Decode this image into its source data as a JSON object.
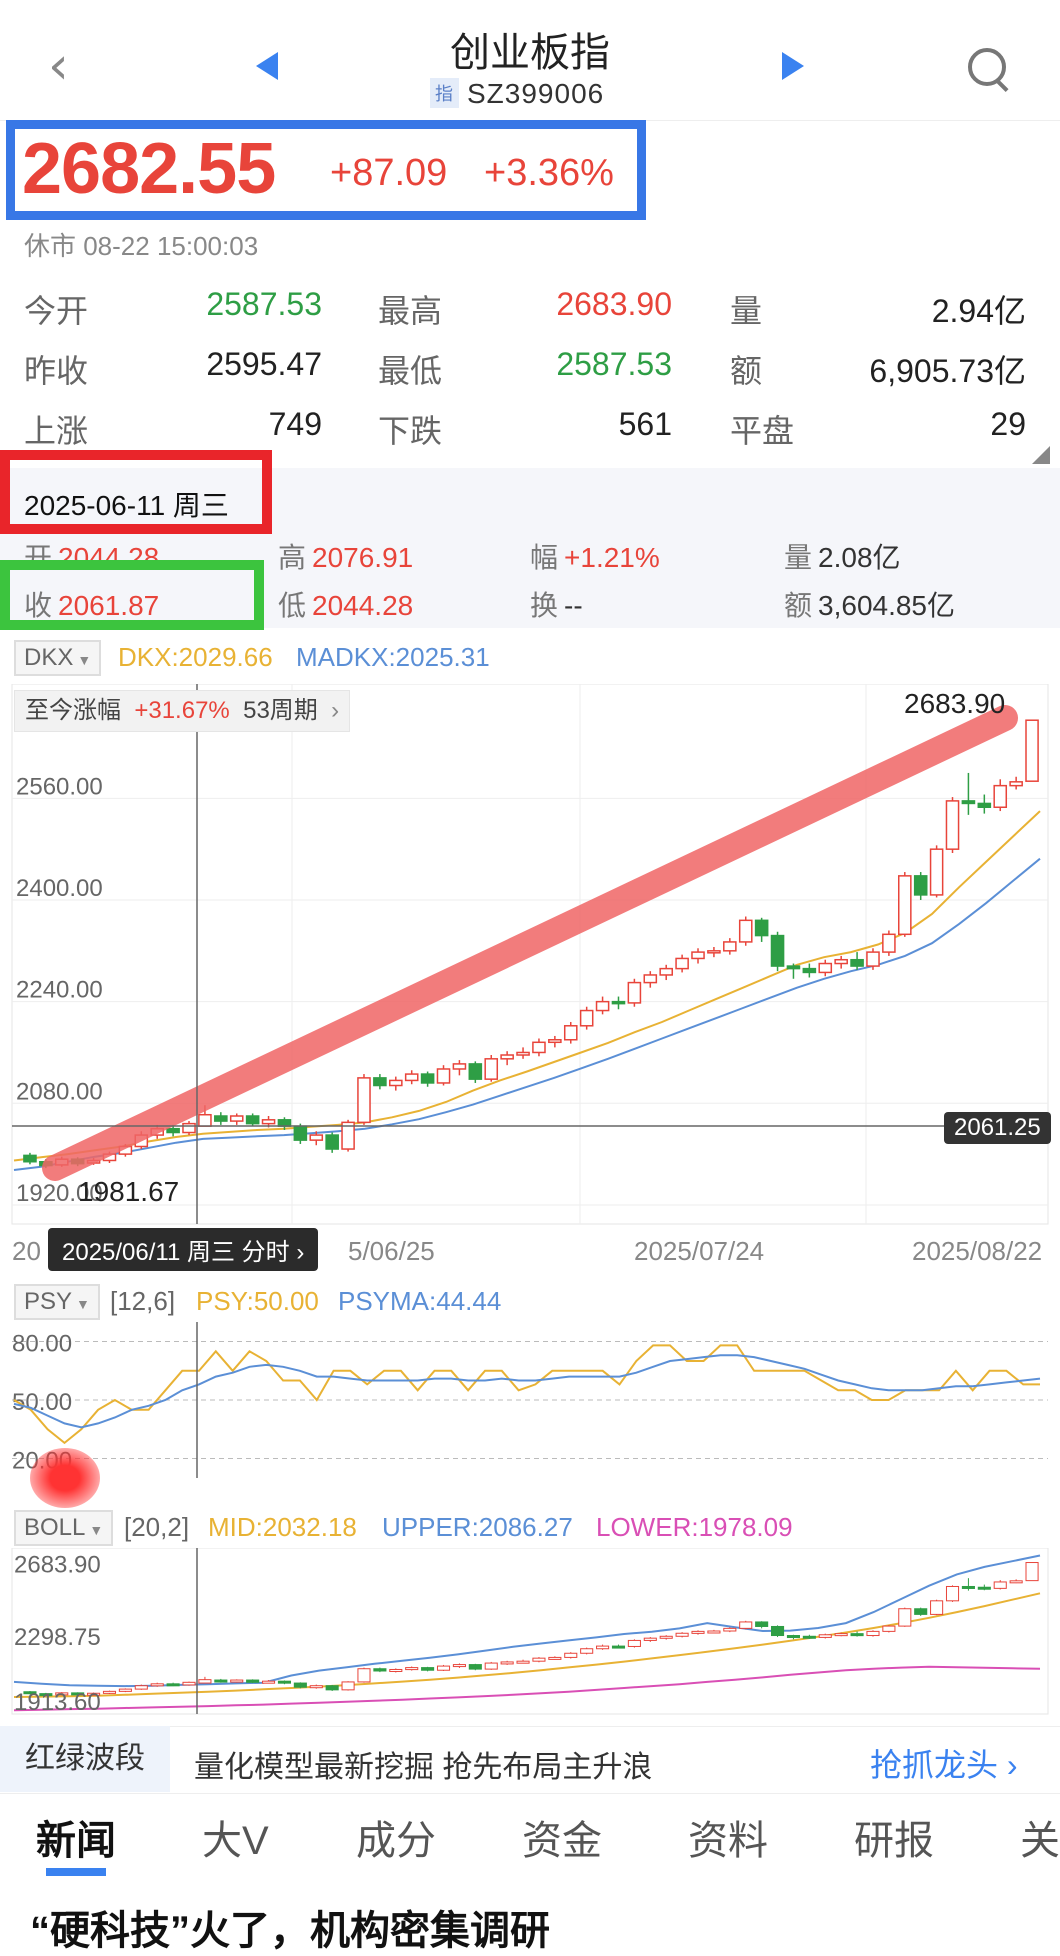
{
  "header": {
    "title": "创业板指",
    "code_badge": "指",
    "code": "SZ399006",
    "back_glyph": "‹"
  },
  "quote": {
    "price": "2682.55",
    "change": "+87.09",
    "change_pct": "+3.36%",
    "status": "休市 08-22 15:00:03"
  },
  "stats": [
    {
      "label": "今开",
      "value": "2587.53",
      "color": "green"
    },
    {
      "label": "最高",
      "value": "2683.90",
      "color": "red"
    },
    {
      "label": "量",
      "value": "2.94亿",
      "color": "black"
    },
    {
      "label": "昨收",
      "value": "2595.47",
      "color": "black"
    },
    {
      "label": "最低",
      "value": "2587.53",
      "color": "green"
    },
    {
      "label": "额",
      "value": "6,905.73亿",
      "color": "black"
    },
    {
      "label": "上涨",
      "value": "749",
      "color": "black"
    },
    {
      "label": "下跌",
      "value": "561",
      "color": "black"
    },
    {
      "label": "平盘",
      "value": "29",
      "color": "black"
    }
  ],
  "detail": {
    "date": "2025-06-11 周三",
    "open_label": "开",
    "open": "2044.28",
    "high_label": "高",
    "high": "2076.91",
    "amp_label": "幅",
    "amp": "+1.21%",
    "vol_label": "量",
    "vol": "2.08亿",
    "close_label": "收",
    "close": "2061.87",
    "low_label": "低",
    "low": "2044.28",
    "turn_label": "换",
    "turn": "--",
    "amt_label": "额",
    "amt": "3,604.85亿"
  },
  "dkx": {
    "selector": "DKX",
    "dkx": "DKX:2029.66",
    "madkx": "MADKX:2025.31",
    "range_label": "至今涨幅",
    "range_pct": "+31.67%",
    "range_periods": "53周期",
    "chevron": "›",
    "max_label": "2683.90",
    "min_label": "1981.67",
    "cross_label": "2061.25",
    "date_tip": "2025/06/11 周三  分时 ›",
    "date_ticks": [
      "20",
      "5/06/25",
      "2025/07/24",
      "2025/08/22"
    ]
  },
  "psy": {
    "selector": "PSY",
    "params": "[12,6]",
    "psy": "PSY:50.00",
    "psyma": "PSYMA:44.44"
  },
  "boll": {
    "selector": "BOLL",
    "params": "[20,2]",
    "mid": "MID:2032.18",
    "upper": "UPPER:2086.27",
    "lower": "LOWER:1978.09"
  },
  "promo": {
    "tag": "红绿波段",
    "text": "量化模型最新挖掘 抢先布局主升浪",
    "link": "抢抓龙头 ›"
  },
  "tabs": [
    "新闻",
    "大V",
    "成分",
    "资金",
    "资料",
    "研报",
    "关"
  ],
  "news_headline": "“硬科技”火了，机构密集调研",
  "colors": {
    "up": "#e8443a",
    "down": "#2e9e45",
    "accent": "#3a82f0",
    "ma1": "#e8b234",
    "ma2": "#5b8fd6",
    "lower": "#d94fb5"
  },
  "chart_data": [
    {
      "type": "candlestick",
      "title": "",
      "yticks": [
        2560.0,
        2400.0,
        2240.0,
        2080.0,
        1920.0
      ],
      "ylim": [
        1890,
        2740
      ],
      "annotations": {
        "high": 2683.9,
        "low": 1981.67,
        "crosshair": 2061.25
      },
      "candles": [
        [
          1998,
          1988,
          2002,
          1984
        ],
        [
          1988,
          1982,
          1992,
          1978
        ],
        [
          1983,
          1992,
          1996,
          1980
        ],
        [
          1992,
          1985,
          1995,
          1981
        ],
        [
          1986,
          1990,
          1994,
          1983
        ],
        [
          1990,
          2000,
          2004,
          1986
        ],
        [
          2000,
          2012,
          2016,
          1996
        ],
        [
          2012,
          2030,
          2036,
          2008
        ],
        [
          2030,
          2040,
          2046,
          2024
        ],
        [
          2040,
          2034,
          2046,
          2028
        ],
        [
          2034,
          2048,
          2052,
          2030
        ],
        [
          2044,
          2062,
          2077,
          2044
        ],
        [
          2060,
          2052,
          2066,
          2046
        ],
        [
          2052,
          2060,
          2064,
          2046
        ],
        [
          2060,
          2048,
          2064,
          2044
        ],
        [
          2048,
          2054,
          2060,
          2042
        ],
        [
          2054,
          2044,
          2058,
          2038
        ],
        [
          2044,
          2022,
          2048,
          2016
        ],
        [
          2022,
          2030,
          2036,
          2014
        ],
        [
          2030,
          2008,
          2034,
          2002
        ],
        [
          2008,
          2050,
          2054,
          2004
        ],
        [
          2050,
          2120,
          2126,
          2046
        ],
        [
          2120,
          2108,
          2126,
          2102
        ],
        [
          2108,
          2116,
          2122,
          2100
        ],
        [
          2116,
          2126,
          2132,
          2110
        ],
        [
          2126,
          2112,
          2130,
          2106
        ],
        [
          2112,
          2134,
          2140,
          2108
        ],
        [
          2134,
          2142,
          2148,
          2124
        ],
        [
          2142,
          2118,
          2146,
          2112
        ],
        [
          2118,
          2150,
          2156,
          2114
        ],
        [
          2150,
          2156,
          2162,
          2140
        ],
        [
          2156,
          2160,
          2168,
          2150
        ],
        [
          2160,
          2176,
          2182,
          2154
        ],
        [
          2176,
          2180,
          2186,
          2168
        ],
        [
          2180,
          2202,
          2208,
          2174
        ],
        [
          2202,
          2226,
          2232,
          2196
        ],
        [
          2226,
          2240,
          2248,
          2220
        ],
        [
          2240,
          2238,
          2248,
          2228
        ],
        [
          2238,
          2270,
          2276,
          2232
        ],
        [
          2270,
          2282,
          2288,
          2262
        ],
        [
          2282,
          2292,
          2298,
          2274
        ],
        [
          2292,
          2308,
          2314,
          2286
        ],
        [
          2308,
          2318,
          2324,
          2300
        ],
        [
          2318,
          2320,
          2326,
          2310
        ],
        [
          2320,
          2334,
          2340,
          2314
        ],
        [
          2334,
          2368,
          2374,
          2328
        ],
        [
          2368,
          2344,
          2372,
          2334
        ],
        [
          2344,
          2296,
          2350,
          2288
        ],
        [
          2296,
          2292,
          2300,
          2276
        ],
        [
          2292,
          2286,
          2300,
          2278
        ],
        [
          2286,
          2300,
          2306,
          2280
        ],
        [
          2300,
          2306,
          2312,
          2292
        ],
        [
          2306,
          2296,
          2318,
          2290
        ],
        [
          2296,
          2318,
          2324,
          2290
        ],
        [
          2318,
          2346,
          2352,
          2312
        ],
        [
          2346,
          2438,
          2444,
          2342
        ],
        [
          2438,
          2408,
          2444,
          2400
        ],
        [
          2408,
          2480,
          2486,
          2404
        ],
        [
          2480,
          2556,
          2562,
          2474
        ],
        [
          2556,
          2552,
          2600,
          2534
        ],
        [
          2552,
          2546,
          2566,
          2536
        ],
        [
          2546,
          2580,
          2590,
          2540
        ],
        [
          2580,
          2586,
          2594,
          2574
        ],
        [
          2587,
          2683,
          2684,
          2587
        ]
      ],
      "series": [
        {
          "name": "DKX",
          "values": [
            1990,
            1995,
            2000,
            2006,
            2012,
            2020,
            2027,
            2032,
            2035,
            2038,
            2040,
            2043,
            2046,
            2050,
            2058,
            2068,
            2082,
            2100,
            2116,
            2130,
            2145,
            2160,
            2175,
            2192,
            2208,
            2226,
            2244,
            2262,
            2280,
            2298,
            2310,
            2318,
            2330,
            2348,
            2378,
            2420,
            2460,
            2500,
            2540
          ]
        },
        {
          "name": "MADKX",
          "values": [
            1975,
            1980,
            1988,
            1996,
            2002,
            2010,
            2018,
            2024,
            2026,
            2028,
            2030,
            2033,
            2036,
            2040,
            2047,
            2055,
            2066,
            2078,
            2092,
            2106,
            2120,
            2135,
            2150,
            2166,
            2182,
            2198,
            2214,
            2230,
            2246,
            2262,
            2276,
            2288,
            2298,
            2312,
            2332,
            2362,
            2395,
            2430,
            2465
          ]
        }
      ]
    },
    {
      "type": "line",
      "title": "",
      "yticks": [
        80.0,
        50.0,
        20.0
      ],
      "ylim": [
        10,
        90
      ],
      "series": [
        {
          "name": "PSY",
          "values": [
            50,
            45,
            35,
            28,
            35,
            45,
            50,
            45,
            45,
            55,
            65,
            65,
            75,
            65,
            75,
            70,
            60,
            60,
            50,
            65,
            65,
            58,
            65,
            65,
            55,
            65,
            65,
            55,
            65,
            65,
            55,
            58,
            65,
            65,
            65,
            65,
            58,
            70,
            78,
            78,
            70,
            70,
            78,
            78,
            65,
            65,
            65,
            65,
            60,
            55,
            55,
            50,
            50,
            55,
            55,
            55,
            65,
            55,
            65,
            65,
            58,
            58
          ]
        },
        {
          "name": "PSYMA",
          "values": [
            48,
            46,
            42,
            38,
            36,
            38,
            41,
            45,
            47,
            50,
            55,
            58,
            62,
            64,
            67,
            68,
            67,
            65,
            62,
            62,
            61,
            60,
            60,
            60,
            60,
            61,
            61,
            60,
            60,
            61,
            60,
            60,
            61,
            62,
            62,
            62,
            62,
            64,
            67,
            70,
            71,
            72,
            73,
            73,
            72,
            70,
            68,
            66,
            63,
            60,
            58,
            56,
            55,
            55,
            55,
            56,
            57,
            57,
            58,
            59,
            60,
            61
          ]
        }
      ]
    },
    {
      "type": "line",
      "title": "",
      "yticks": [
        2683.9,
        2298.75,
        1913.6
      ],
      "ylim": [
        1880,
        2760
      ],
      "series": [
        {
          "name": "MID",
          "values": [
            1970,
            1972,
            1974,
            1977,
            1982,
            1987,
            1993,
            1998,
            2004,
            2011,
            2018,
            2025,
            2033,
            2042,
            2052,
            2062,
            2073,
            2085,
            2098,
            2112,
            2127,
            2142,
            2158,
            2175,
            2192,
            2210,
            2229,
            2248,
            2268,
            2290,
            2312,
            2336,
            2362,
            2390,
            2420,
            2452,
            2486,
            2520
          ]
        },
        {
          "name": "UPPER",
          "values": [
            2050,
            2040,
            2032,
            2030,
            2028,
            2030,
            2034,
            2038,
            2042,
            2046,
            2084,
            2110,
            2128,
            2146,
            2162,
            2178,
            2196,
            2216,
            2236,
            2254,
            2270,
            2286,
            2304,
            2316,
            2334,
            2362,
            2340,
            2320,
            2322,
            2336,
            2362,
            2420,
            2490,
            2560,
            2620,
            2660,
            2690,
            2720
          ]
        },
        {
          "name": "LOWER",
          "values": [
            1900,
            1903,
            1906,
            1908,
            1912,
            1915,
            1918,
            1922,
            1926,
            1930,
            1935,
            1940,
            1945,
            1950,
            1956,
            1962,
            1968,
            1975,
            1982,
            1990,
            1998,
            2008,
            2018,
            2028,
            2038,
            2050,
            2062,
            2074,
            2088,
            2100,
            2112,
            2120,
            2126,
            2130,
            2128,
            2125,
            2122,
            2120
          ]
        }
      ]
    }
  ]
}
